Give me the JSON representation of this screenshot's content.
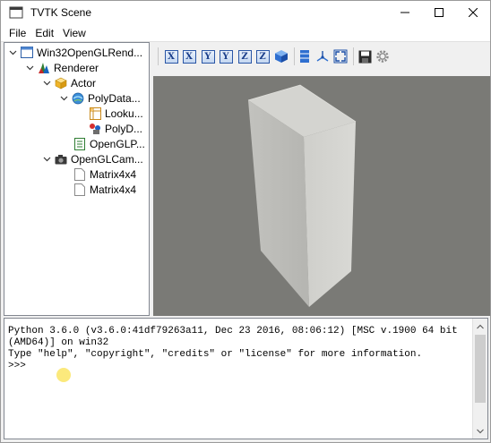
{
  "window": {
    "title": "TVTK Scene",
    "controls": [
      "minimize",
      "maximize",
      "close"
    ]
  },
  "menu": {
    "items": [
      "File",
      "Edit",
      "View"
    ]
  },
  "tree": {
    "nodes": [
      {
        "label": "Win32OpenGLRend...",
        "icon": "window-icon",
        "expanded": true
      },
      {
        "label": "Renderer",
        "icon": "renderer-icon",
        "expanded": true
      },
      {
        "label": "Actor",
        "icon": "actor-cube-icon",
        "expanded": true
      },
      {
        "label": "PolyData...",
        "icon": "polydata-globe-icon",
        "expanded": true
      },
      {
        "label": "Looku...",
        "icon": "lookup-table-icon"
      },
      {
        "label": "PolyD...",
        "icon": "polydata-filter-icon"
      },
      {
        "label": "OpenGLP...",
        "icon": "property-icon"
      },
      {
        "label": "OpenGLCam...",
        "icon": "camera-icon",
        "expanded": true
      },
      {
        "label": "Matrix4x4",
        "icon": "document-icon"
      },
      {
        "label": "Matrix4x4",
        "icon": "document-icon"
      }
    ]
  },
  "toolbar": {
    "view_buttons": [
      "X",
      "X",
      "Y",
      "Y",
      "Z",
      "Z"
    ],
    "icons": [
      "isometric-cube-icon",
      "parallel-projection-icon",
      "axes-toggle-icon",
      "fullscreen-icon",
      "save-icon",
      "settings-gear-icon"
    ]
  },
  "scene": {
    "background": "#7a7a76",
    "object": "box"
  },
  "console": {
    "lines": [
      "Python 3.6.0 (v3.6.0:41df79263a11, Dec 23 2016, 08:06:12) [MSC v.1900 64 bit",
      "(AMD64)] on win32",
      "Type \"help\", \"copyright\", \"credits\" or \"license\" for more information.",
      ">>>"
    ]
  }
}
